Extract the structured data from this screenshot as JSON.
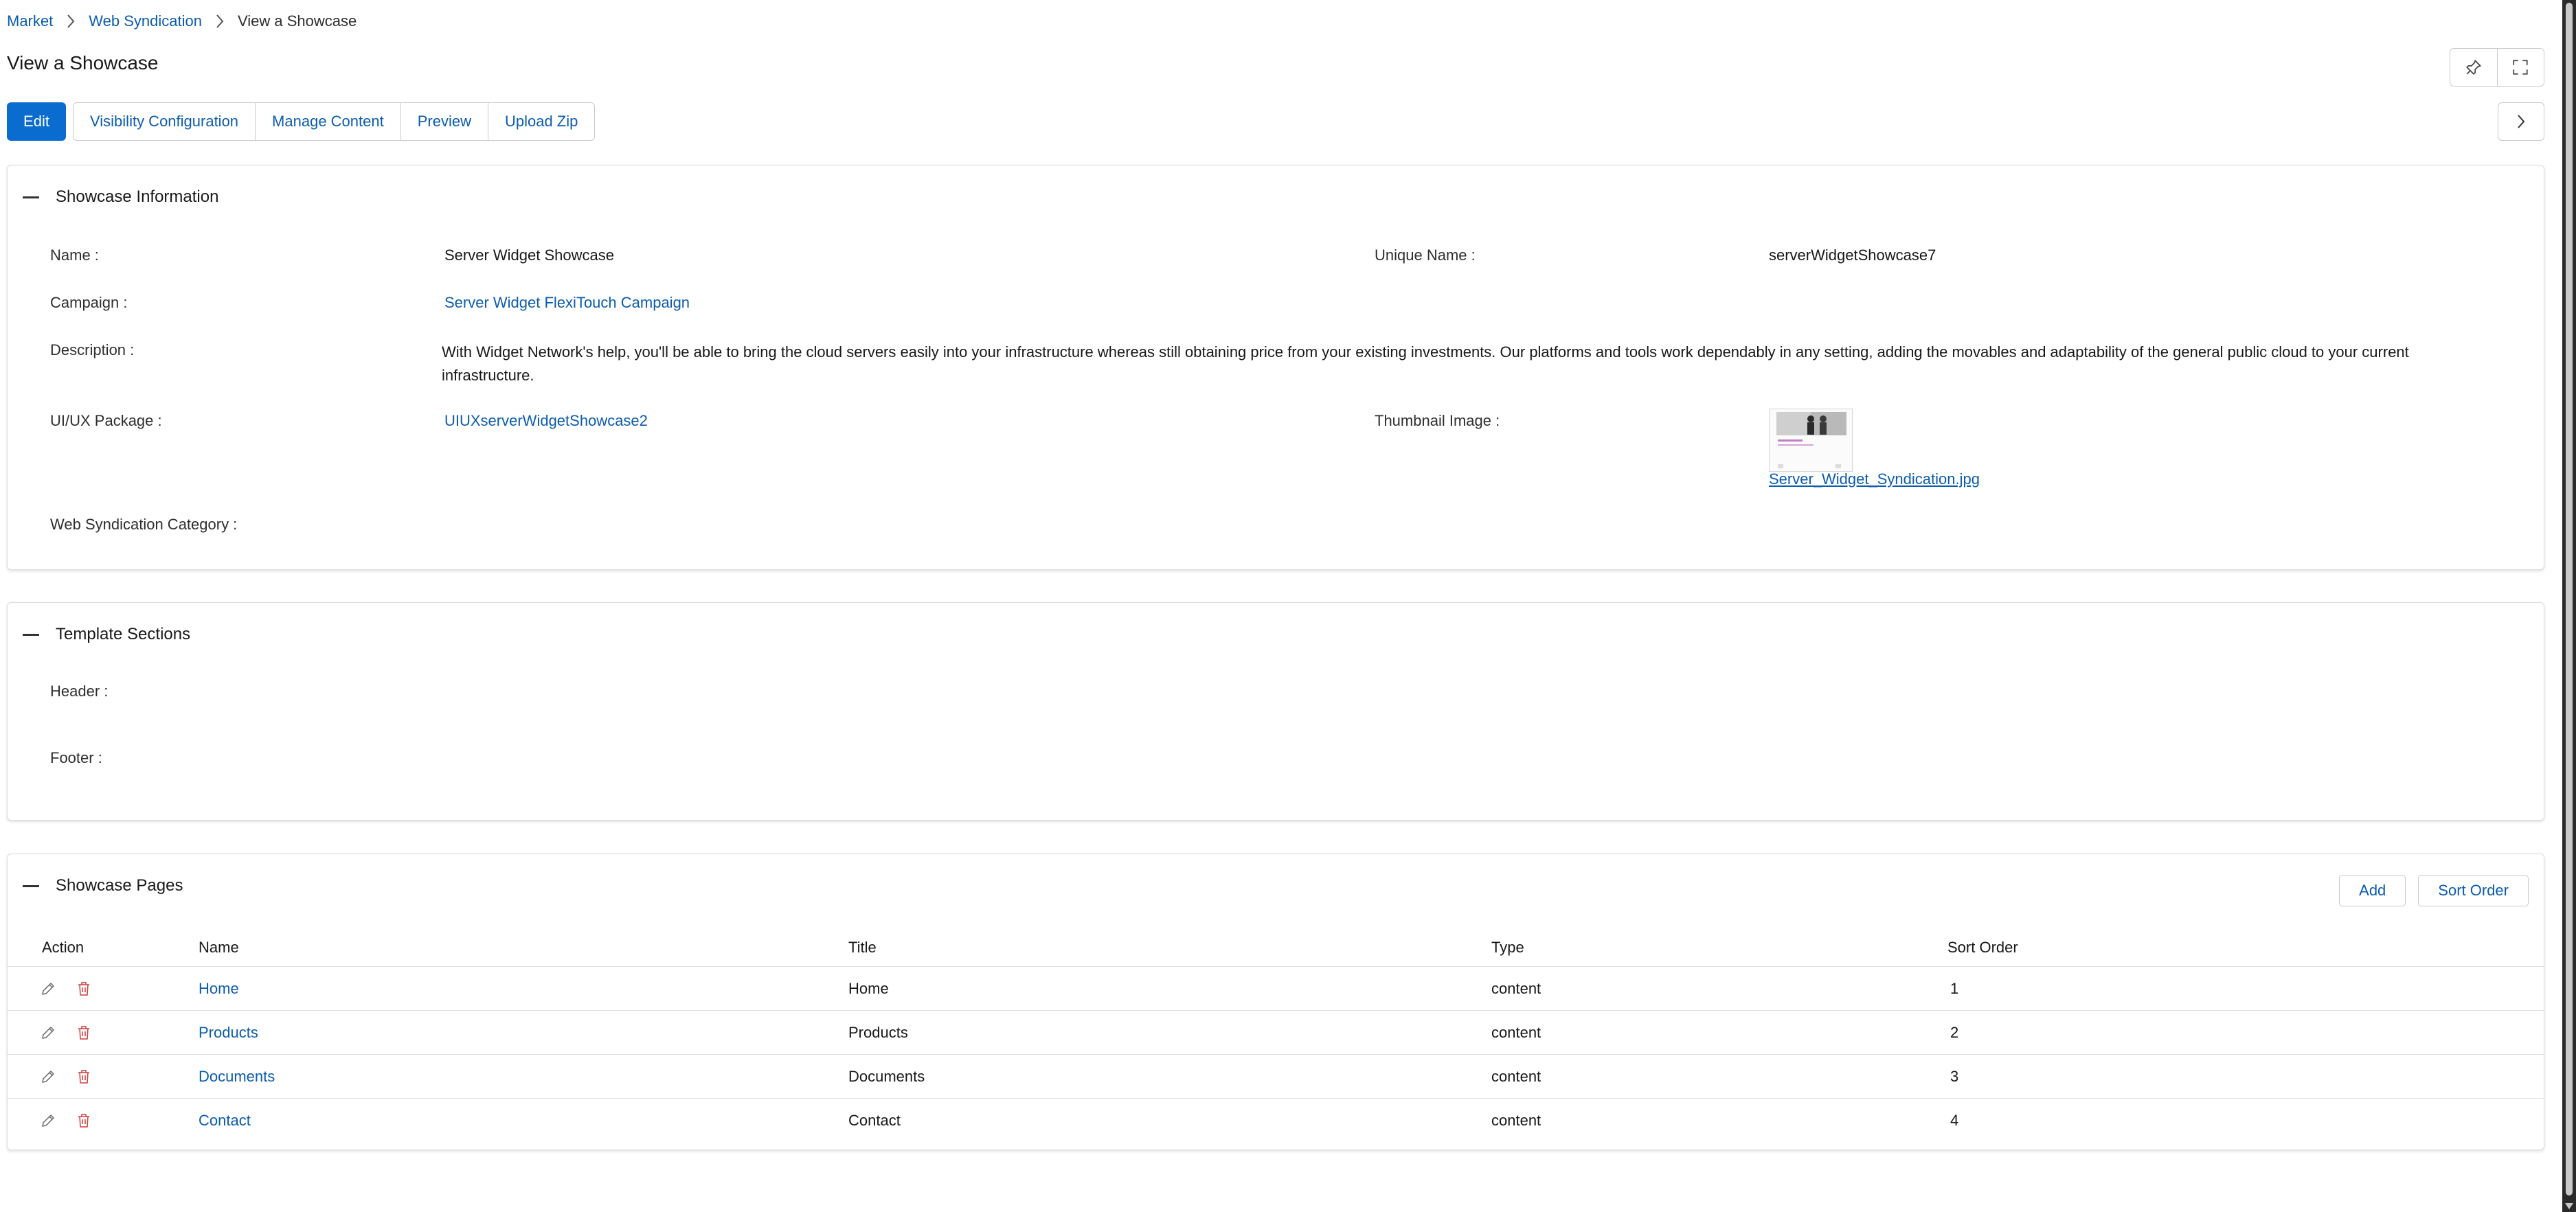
{
  "breadcrumb": {
    "items": [
      "Market",
      "Web Syndication"
    ],
    "current": "View a Showcase"
  },
  "page_title": "View a Showcase",
  "actions": {
    "edit": "Edit",
    "group": [
      "Visibility Configuration",
      "Manage Content",
      "Preview",
      "Upload Zip"
    ]
  },
  "info": {
    "title": "Showcase Information",
    "name_label": "Name :",
    "name_value": "Server Widget Showcase",
    "unique_label": "Unique Name :",
    "unique_value": "serverWidgetShowcase7",
    "campaign_label": "Campaign :",
    "campaign_value": "Server Widget FlexiTouch Campaign",
    "description_label": "Description :",
    "description_value": "With Widget Network's help, you'll be able to bring the cloud servers easily into your infrastructure whereas still obtaining price from your existing investments. Our platforms and tools work dependably in any setting, adding the movables and adaptability of the general public cloud to your current infrastructure.",
    "uiux_label": "UI/UX Package :",
    "uiux_value": "UIUXserverWidgetShowcase2",
    "thumb_label": "Thumbnail Image :",
    "thumb_file": "Server_Widget_Syndication.jpg",
    "category_label": "Web Syndication Category :"
  },
  "template": {
    "title": "Template Sections",
    "header_label": "Header :",
    "footer_label": "Footer :"
  },
  "pages": {
    "title": "Showcase Pages",
    "add": "Add",
    "sort": "Sort Order",
    "columns": [
      "Action",
      "Name",
      "Title",
      "Type",
      "Sort Order"
    ],
    "rows": [
      {
        "name": "Home",
        "title": "Home",
        "type": "content",
        "order": "1"
      },
      {
        "name": "Products",
        "title": "Products",
        "type": "content",
        "order": "2"
      },
      {
        "name": "Documents",
        "title": "Documents",
        "type": "content",
        "order": "3"
      },
      {
        "name": "Contact",
        "title": "Contact",
        "type": "content",
        "order": "4"
      }
    ]
  },
  "colors": {
    "primary": "#0b6ccf",
    "link": "#0b5cad",
    "delete": "#d23c3c"
  },
  "icons": {
    "pin": "pin-icon",
    "fullscreen": "fullscreen-icon",
    "chevron": "chevron-right-icon",
    "edit": "pencil-icon",
    "delete": "trash-icon"
  }
}
